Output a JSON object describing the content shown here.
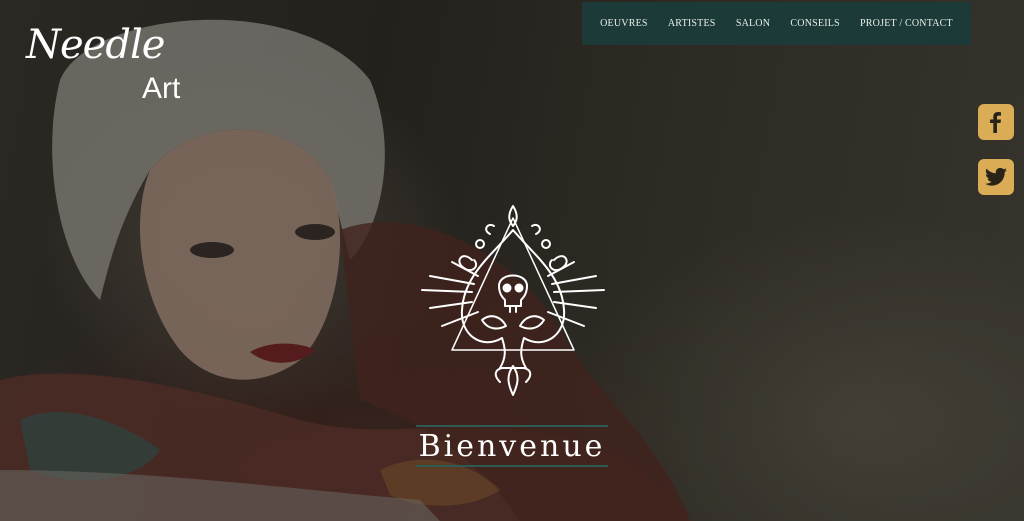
{
  "logo": {
    "script": "Needle",
    "sub": "Art"
  },
  "nav": {
    "items": [
      {
        "label": "OEUVRES"
      },
      {
        "label": "ARTISTES"
      },
      {
        "label": "SALON"
      },
      {
        "label": "CONSEILS"
      },
      {
        "label": "PROJET / CONTACT"
      }
    ]
  },
  "social": {
    "icons": [
      "facebook-icon",
      "twitter-icon"
    ]
  },
  "hero": {
    "welcome": "Bienvenue"
  },
  "colors": {
    "nav_bg": "#1c3b38",
    "social_bg": "#d9ac55",
    "accent_line": "#2c5b54"
  }
}
